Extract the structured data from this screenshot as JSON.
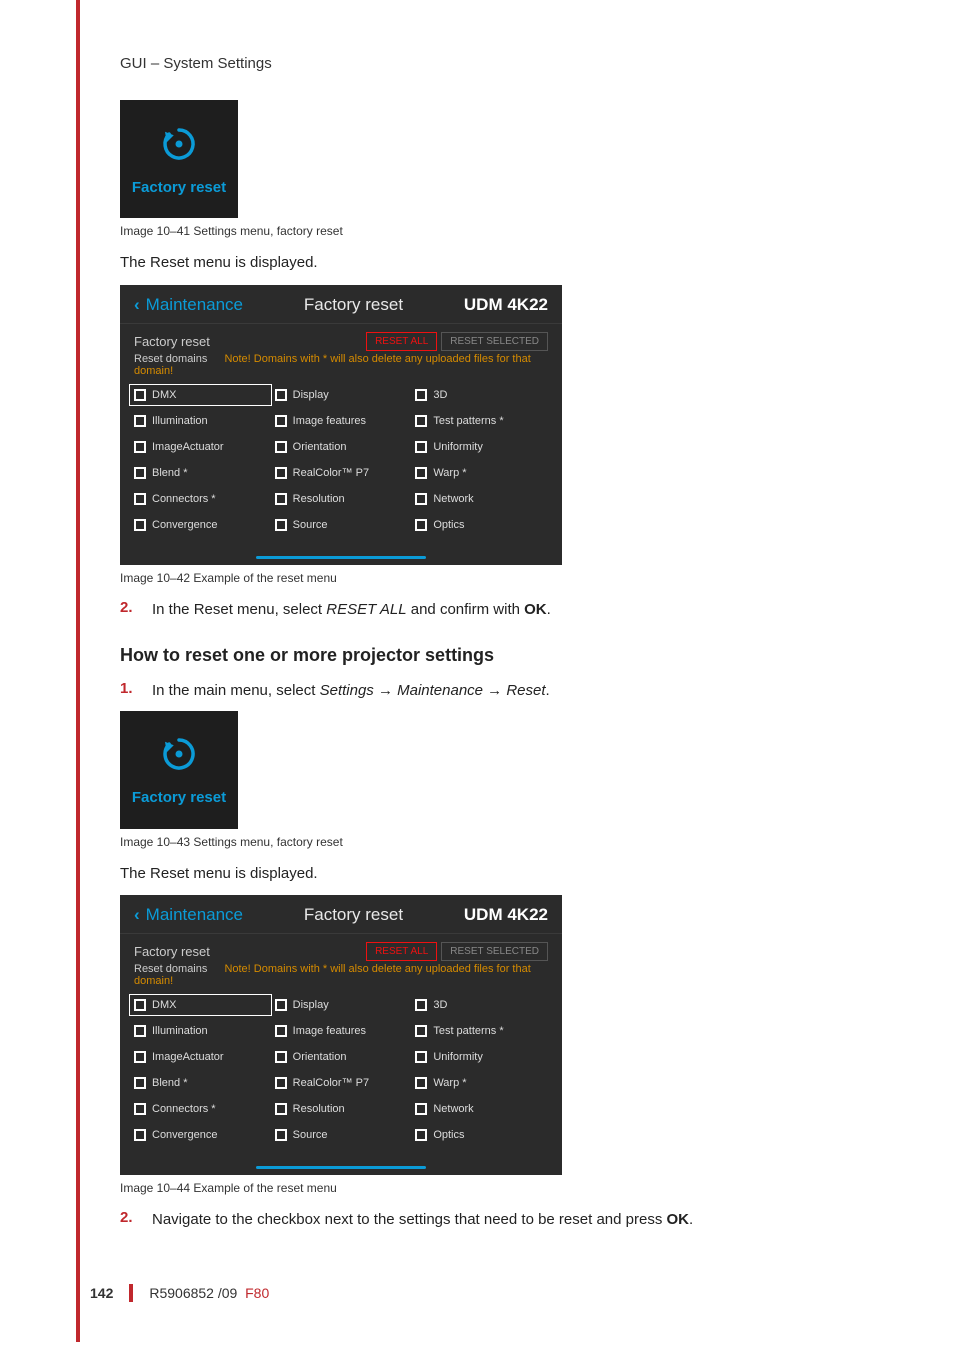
{
  "doc_header": "GUI – System Settings",
  "tile": {
    "label": "Factory reset"
  },
  "captions": {
    "img1": "Image 10–41  Settings menu, factory reset",
    "img2": "Image 10–42  Example of the reset menu",
    "img3": "Image 10–43  Settings menu, factory reset",
    "img4": "Image 10–44  Example of the reset menu"
  },
  "text": {
    "reset_displayed": "The Reset menu is displayed.",
    "step2a_pre": "In the Reset menu, select ",
    "step2a_em": "RESET ALL",
    "step2a_post": " and confirm with ",
    "step2a_ok": "OK",
    "step2a_end": ".",
    "heading": "How to reset one or more projector settings",
    "step1b_pre": "In the main menu, select ",
    "step1b_em": "Settings → Maintenance → Reset",
    "step1b_end": ".",
    "step2b": "Navigate to the checkbox next to the settings that need to be reset and press ",
    "step2b_ok": "OK",
    "step2b_end": "."
  },
  "screenshot": {
    "maintenance": "Maintenance",
    "title": "Factory reset",
    "model": "UDM 4K22",
    "sub_left": "Factory reset",
    "btn_reset_all": "RESET ALL",
    "btn_reset_selected": "RESET SELECTED",
    "reset_domains": "Reset domains",
    "note": "Note! Domains with * will also delete any uploaded files for that domain!",
    "items_col1": [
      "DMX",
      "Illumination",
      "ImageActuator",
      "Blend *",
      "Connectors *",
      "Convergence"
    ],
    "items_col2": [
      "Display",
      "Image features",
      "Orientation",
      "RealColor™ P7",
      "Resolution",
      "Source"
    ],
    "items_col3": [
      "3D",
      "Test patterns *",
      "Uniformity",
      "Warp *",
      "Network",
      "Optics"
    ]
  },
  "footer": {
    "page": "142",
    "code": "R5906852 /09",
    "fcode": "F80"
  }
}
